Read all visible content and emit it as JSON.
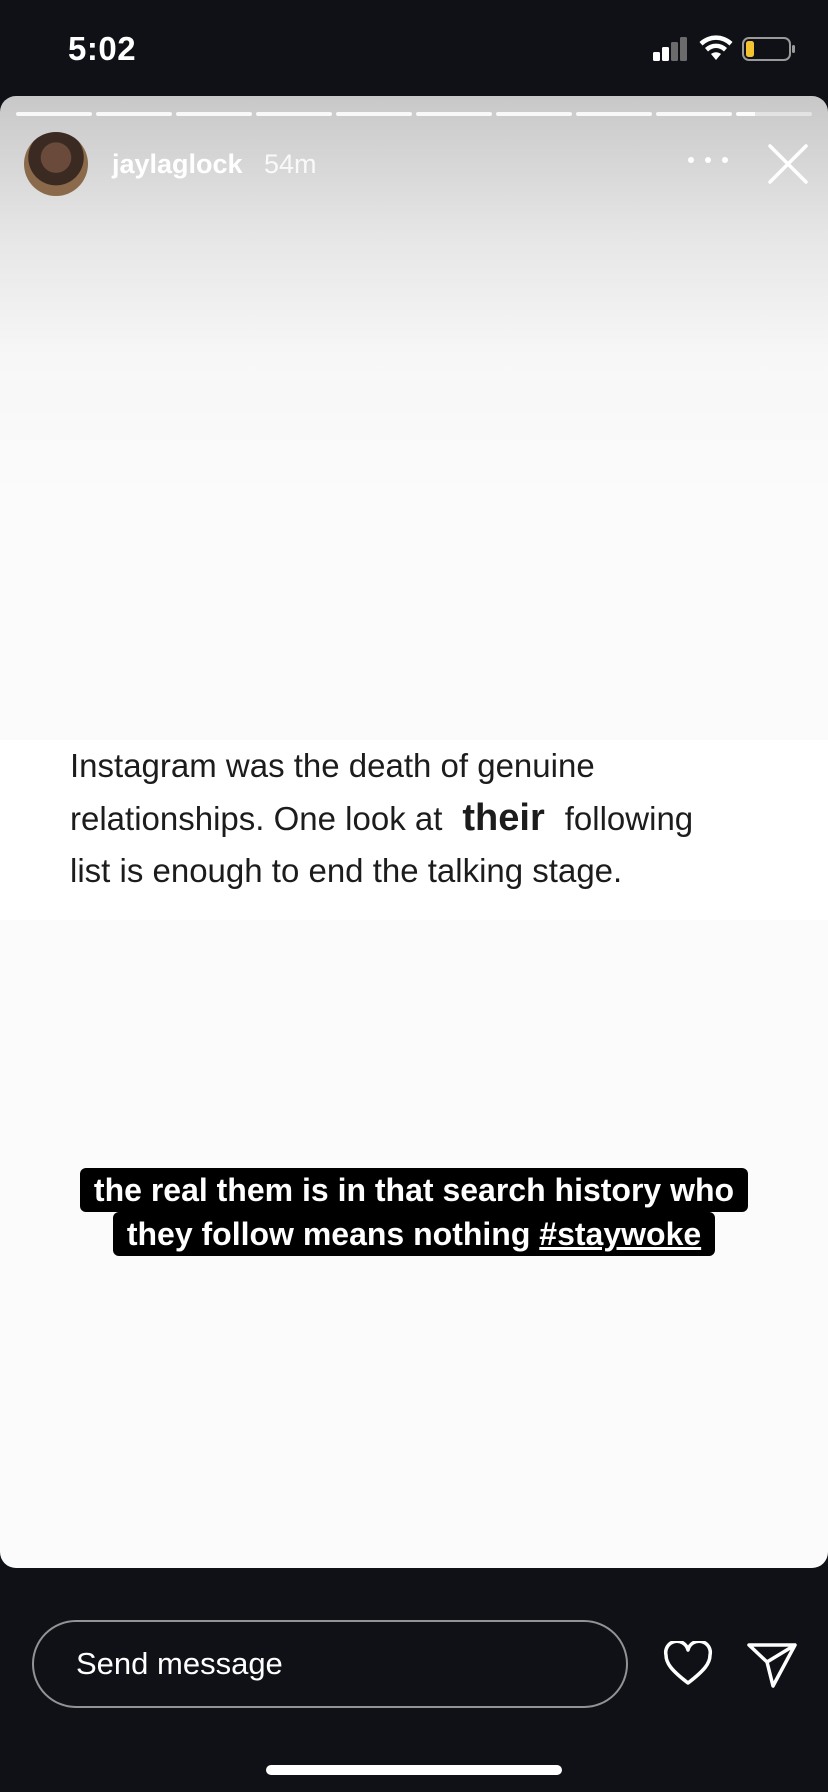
{
  "status_bar": {
    "time": "5:02",
    "signal_icon": "cellular-signal-icon",
    "wifi_icon": "wifi-icon",
    "battery_icon": "battery-low-icon",
    "battery_color": "#f4c430"
  },
  "story": {
    "segments_total": 10,
    "segments_viewed": 9,
    "current_segment_progress": 0.25,
    "username": "jaylaglock",
    "time_ago": "54m",
    "more_icon": "more-horizontal-icon",
    "close_icon": "close-icon",
    "screenshot_text": {
      "line1": "Instagram was the death of genuine",
      "line2_before": "relationships. One look at",
      "line2_emphasis": "their",
      "line2_after": "following",
      "line3": "list is enough to end the talking stage."
    },
    "caption": {
      "line1": "the real them is in that search history who",
      "line2_text": "they follow means nothing ",
      "hashtag": "#staywoke"
    }
  },
  "reply_bar": {
    "placeholder": "Send message",
    "like_icon": "heart-icon",
    "share_icon": "send-icon"
  }
}
